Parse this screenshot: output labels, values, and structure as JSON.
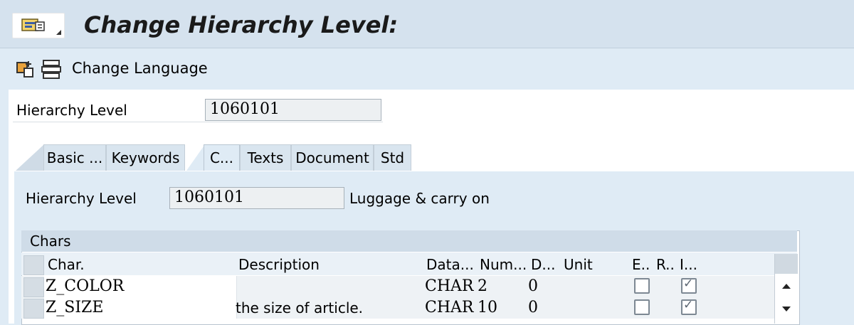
{
  "window": {
    "title": "Change Hierarchy Level:"
  },
  "toolbar": {
    "change_language_label": "Change Language"
  },
  "header": {
    "hierarchy_level_label": "Hierarchy Level",
    "hierarchy_level_value": "1060101"
  },
  "tabs": [
    {
      "label": "Basic ...",
      "active": false
    },
    {
      "label": "Keywords",
      "active": false
    },
    {
      "label": "C...",
      "active": true
    },
    {
      "label": "Texts",
      "active": false
    },
    {
      "label": "Document",
      "active": false
    },
    {
      "label": "Std",
      "active": false
    }
  ],
  "chars_tab": {
    "hierarchy_level_label": "Hierarchy Level",
    "hierarchy_level_value": "1060101",
    "hierarchy_level_desc": "Luggage & carry on",
    "table": {
      "title": "Chars",
      "columns": [
        "Char.",
        "Description",
        "Data...",
        "Num...",
        "D...",
        "Unit",
        "E..",
        "R..",
        "I..."
      ],
      "rows": [
        {
          "char": "Z_COLOR",
          "description": "",
          "datatype": "CHAR",
          "num": "2",
          "dec": "0",
          "unit": "",
          "e": false,
          "r": null,
          "i": true
        },
        {
          "char": "Z_SIZE",
          "description": "the size of article.",
          "datatype": "CHAR",
          "num": "10",
          "dec": "0",
          "unit": "",
          "e": false,
          "r": null,
          "i": true
        }
      ]
    }
  },
  "colors": {
    "background": "#dfebf5",
    "titlebar": "#d5e2ee",
    "panel": "#ffffff",
    "field": "#edf0f2"
  },
  "icons": [
    "menu-icon",
    "tree-icon",
    "list-icon",
    "scroll-up-icon",
    "scroll-down-icon"
  ]
}
